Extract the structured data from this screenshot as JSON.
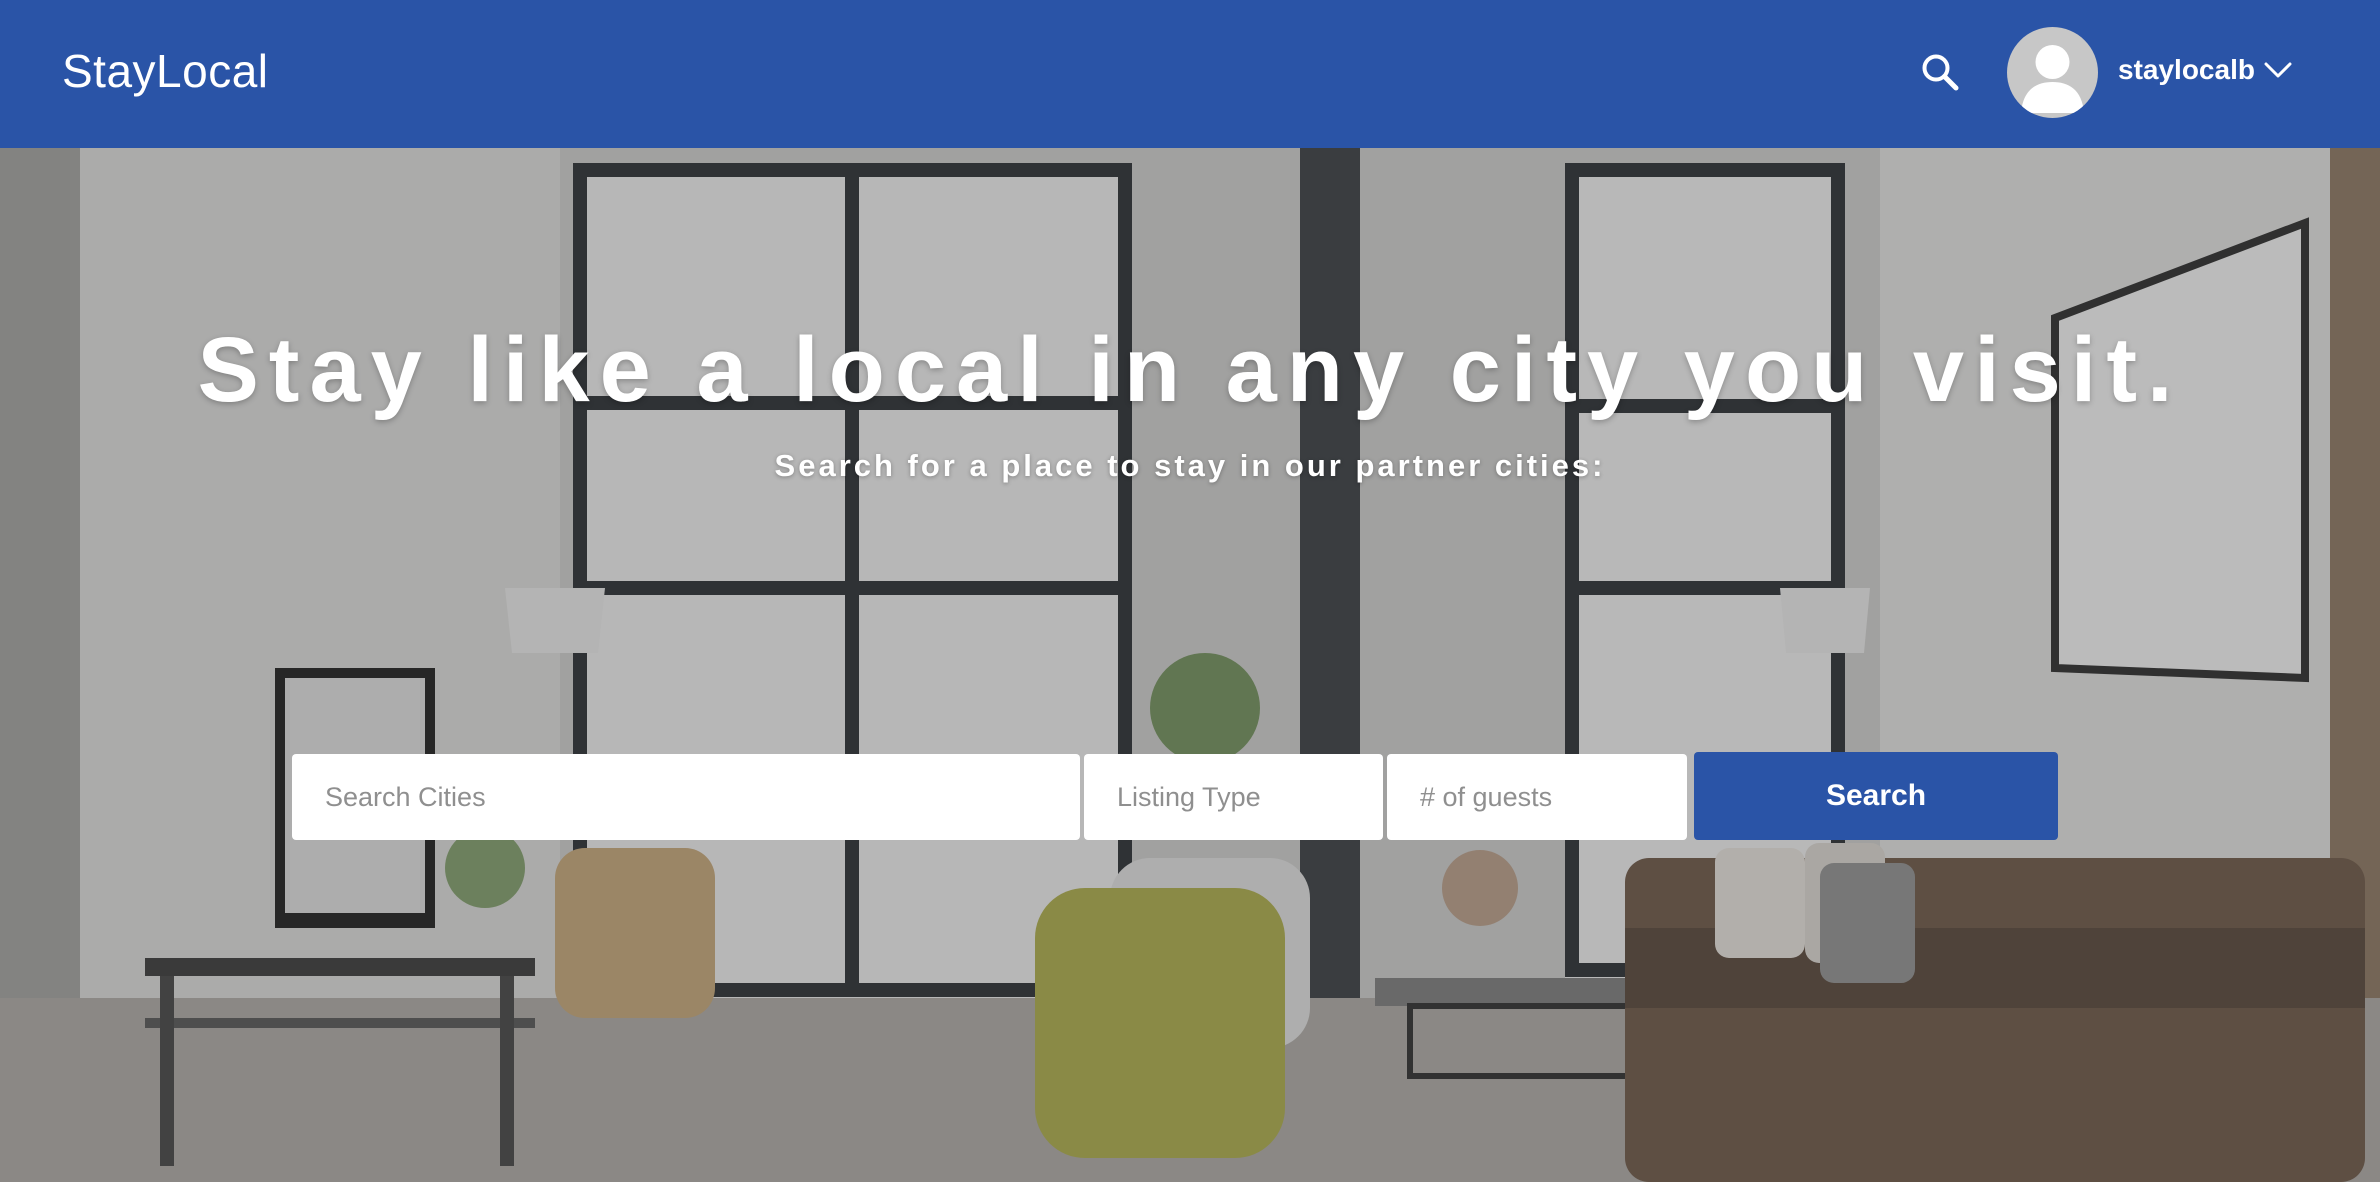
{
  "header": {
    "brand": "StayLocal",
    "search_icon": "search-icon",
    "avatar_icon": "user-avatar-icon",
    "username": "staylocalb",
    "dropdown_icon": "chevron-down-icon"
  },
  "hero": {
    "headline": "Stay like a local in any city you visit.",
    "subheadline": "Search for a place to stay in our partner cities:",
    "background": "living-room-photo"
  },
  "search": {
    "city_placeholder": "Search Cities",
    "listing_type_placeholder": "Listing Type",
    "guests_placeholder": "# of guests",
    "button_label": "Search"
  },
  "colors": {
    "brand_blue": "#2a54a7",
    "text_on_brand": "#ffffff",
    "field_background": "#ffffff",
    "placeholder_gray": "#8f8f8f"
  }
}
